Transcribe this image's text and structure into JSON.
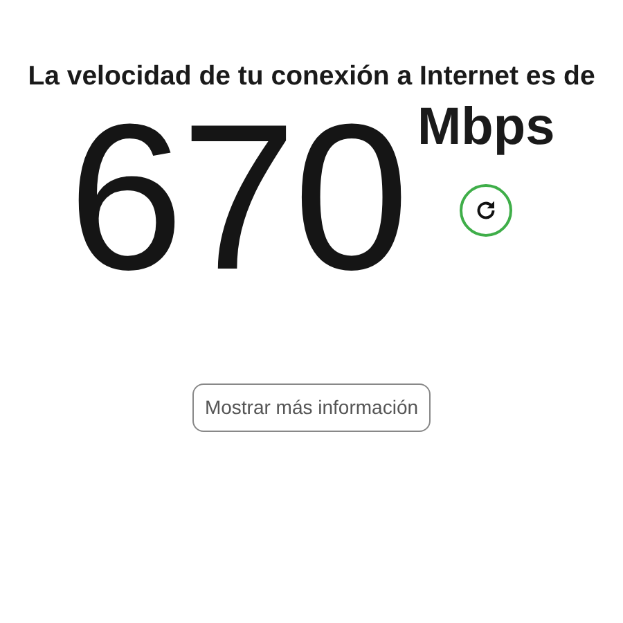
{
  "heading": "La velocidad de tu conexión a Internet es de",
  "speed": {
    "value": "670",
    "unit": "Mbps"
  },
  "more_button": "Mostrar más información"
}
